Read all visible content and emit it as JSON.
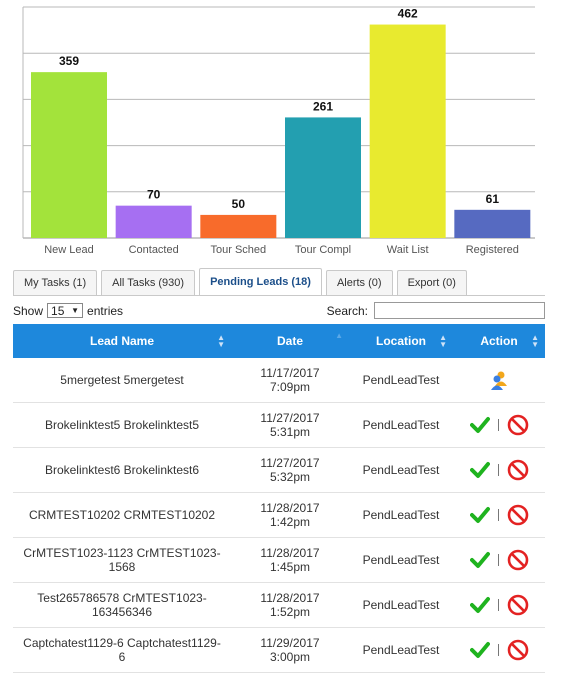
{
  "chart_data": {
    "type": "bar",
    "categories": [
      "New Lead",
      "Contacted",
      "Tour Sched",
      "Tour Compl",
      "Wait List",
      "Registered"
    ],
    "values": [
      359,
      70,
      50,
      261,
      462,
      61
    ],
    "colors": [
      "#a3e33b",
      "#a66ff2",
      "#f86b2b",
      "#239fb0",
      "#e8ea2f",
      "#566ac1"
    ],
    "ylim": [
      0,
      500
    ],
    "grid": true
  },
  "tabs": [
    {
      "label": "My Tasks (1)"
    },
    {
      "label": "All Tasks (930)"
    },
    {
      "label": "Pending Leads (18)",
      "active": true
    },
    {
      "label": "Alerts (0)"
    },
    {
      "label": "Export (0)"
    }
  ],
  "controls": {
    "show_label": "Show",
    "page_size": "15",
    "entries_label": "entries",
    "search_label": "Search:",
    "search_value": ""
  },
  "table": {
    "columns": [
      "Lead Name",
      "Date",
      "Location",
      "Action"
    ],
    "rows": [
      {
        "name": "5mergetest 5mergetest",
        "date": "11/17/2017",
        "time": "7:09pm",
        "location": "PendLeadTest",
        "action": "assign"
      },
      {
        "name": "Brokelinktest5 Brokelinktest5",
        "date": "11/27/2017",
        "time": "5:31pm",
        "location": "PendLeadTest",
        "action": "approve-reject"
      },
      {
        "name": "Brokelinktest6 Brokelinktest6",
        "date": "11/27/2017",
        "time": "5:32pm",
        "location": "PendLeadTest",
        "action": "approve-reject"
      },
      {
        "name": "CRMTEST10202 CRMTEST10202",
        "date": "11/28/2017",
        "time": "1:42pm",
        "location": "PendLeadTest",
        "action": "approve-reject"
      },
      {
        "name": "CrMTEST1023-1123 CrMTEST1023-1568",
        "date": "11/28/2017",
        "time": "1:45pm",
        "location": "PendLeadTest",
        "action": "approve-reject"
      },
      {
        "name": "Test265786578 CrMTEST1023-163456346",
        "date": "11/28/2017",
        "time": "1:52pm",
        "location": "PendLeadTest",
        "action": "approve-reject"
      },
      {
        "name": "Captchatest1129-6 Captchatest1129-6",
        "date": "11/29/2017",
        "time": "3:00pm",
        "location": "PendLeadTest",
        "action": "approve-reject"
      }
    ]
  }
}
